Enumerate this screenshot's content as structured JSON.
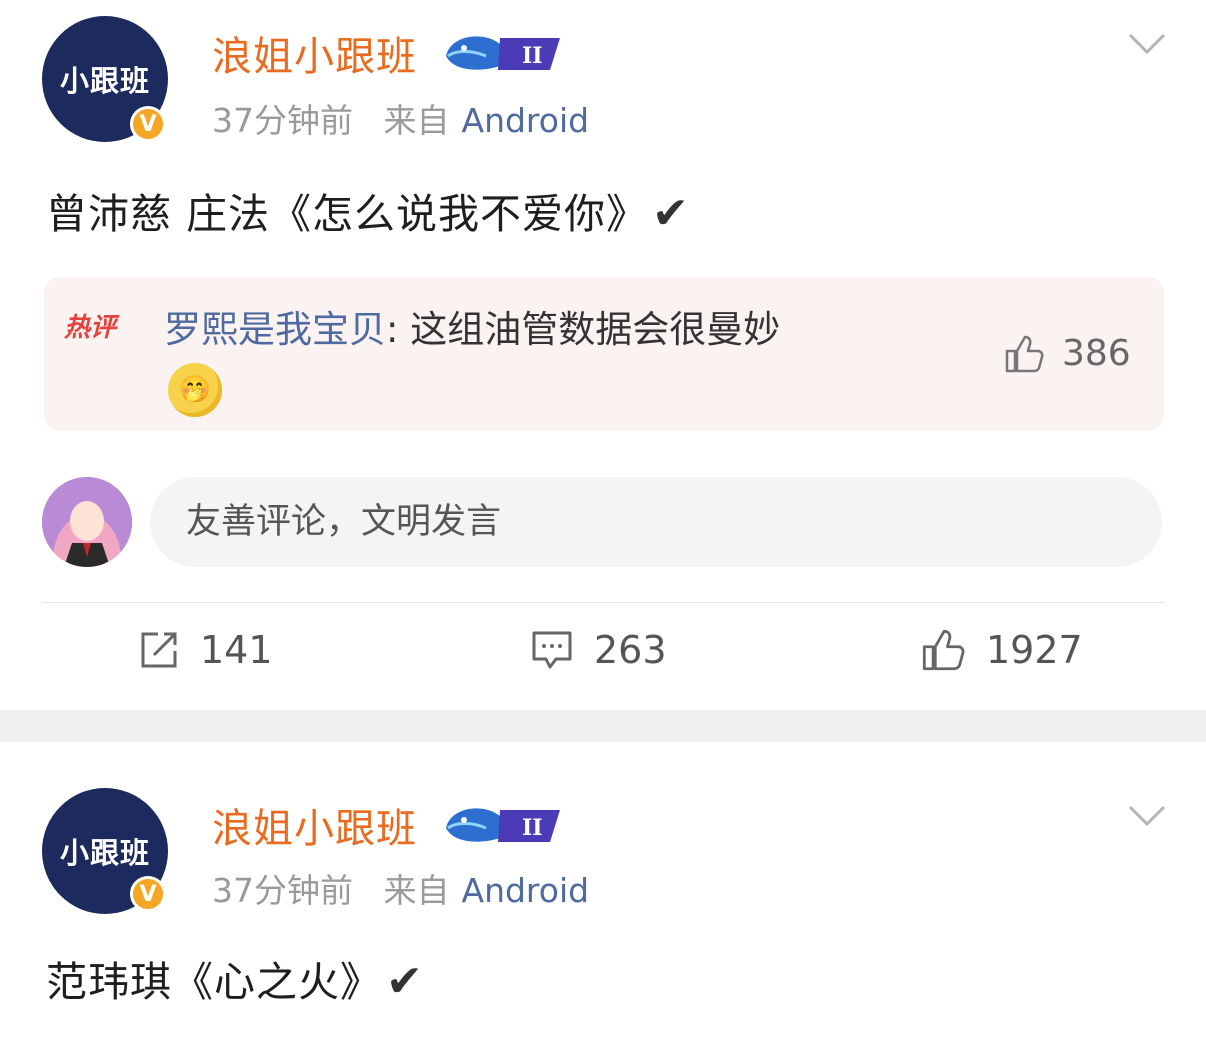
{
  "posts": [
    {
      "avatar_text": "小跟班",
      "verified_badge": "V",
      "username": "浪姐小跟班",
      "level_badge": "II",
      "time": "37分钟前",
      "source_prefix": "来自",
      "source": "Android",
      "content": "曾沛慈 庄法《怎么说我不爱你》",
      "check": "✔",
      "hot_comment": {
        "tag": "热评",
        "user": "罗熙是我宝贝",
        "separator": ": ",
        "text": "这组油管数据会很曼妙",
        "emoji": "🤭",
        "likes": "386"
      },
      "comment_placeholder": "友善评论，文明发言",
      "actions": {
        "reposts": "141",
        "comments": "263",
        "likes": "1927"
      }
    },
    {
      "avatar_text": "小跟班",
      "verified_badge": "V",
      "username": "浪姐小跟班",
      "level_badge": "II",
      "time": "37分钟前",
      "source_prefix": "来自",
      "source": "Android",
      "content": "范玮琪《心之火》",
      "check": "✔"
    }
  ],
  "icons": [
    "chevron-down-icon",
    "whale-level-icon",
    "thumbs-up-icon",
    "repost-icon",
    "comment-icon"
  ],
  "colors": {
    "username": "#e86b1f",
    "link": "#4e6a9e",
    "hot": "#e5413d",
    "avatar_bg": "#1c2a5d",
    "badge": "#f5a623"
  }
}
